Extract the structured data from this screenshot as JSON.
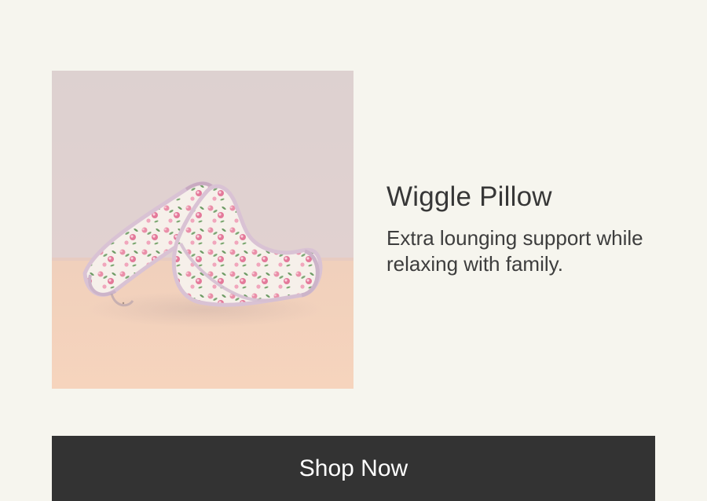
{
  "product": {
    "title": "Wiggle Pillow",
    "description": "Extra lounging support while relaxing with family."
  },
  "cta": {
    "label": "Shop Now"
  },
  "colors": {
    "background": "#f6f5ee",
    "button": "#333333",
    "button_text": "#ffffff",
    "text": "#373737"
  }
}
